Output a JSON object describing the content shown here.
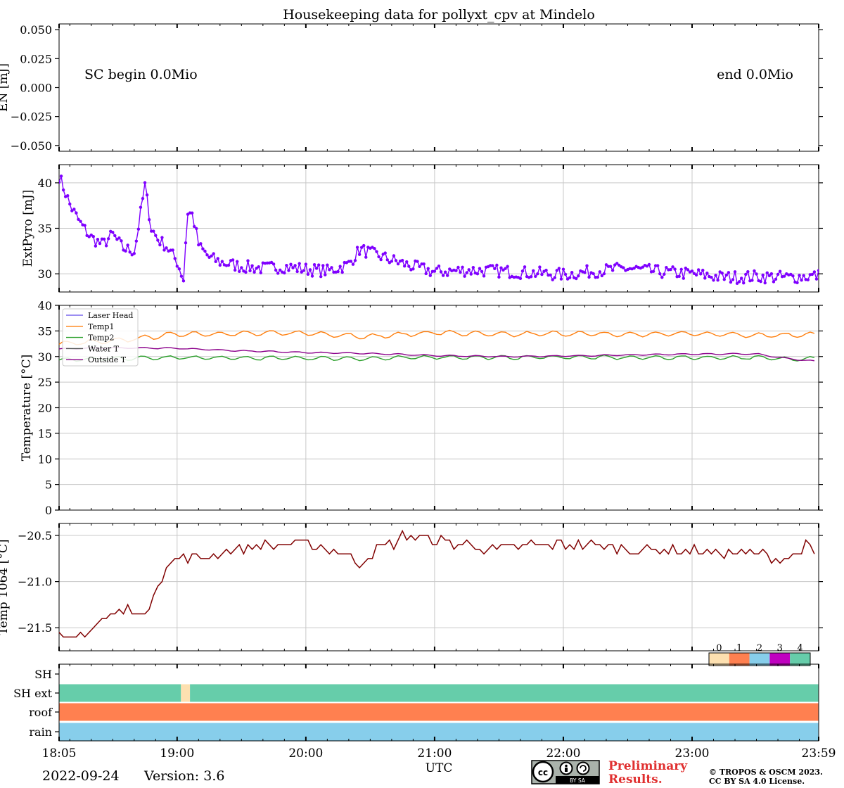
{
  "figure": {
    "title": "Housekeeping data for pollyxt_cpv at Mindelo",
    "date_label": "2022-09-24",
    "version_label": "Version: 3.6",
    "preliminary_line1": "Preliminary",
    "preliminary_line2": "Results.",
    "copyright_line1": "© TROPOS & OSCM 2023.",
    "copyright_line2": "CC BY SA 4.0 License.",
    "license_badge_text": "BY SA",
    "colors": {
      "extpyro": "#7f00ff",
      "temp1": "#ff7f0e",
      "temp2": "#2ca02c",
      "outside": "#8b008b",
      "temp1064": "#800000",
      "grid": "#c8c8c8",
      "preliminary": "#e03030"
    }
  },
  "chart_data": [
    {
      "type": "line",
      "panel": "energy",
      "ylabel": "EN [mJ]",
      "ylim": [
        -0.055,
        0.055
      ],
      "yticks": [
        -0.05,
        -0.025,
        0.0,
        0.025,
        0.05
      ],
      "ytick_labels": [
        "−0.050",
        "−0.025",
        "0.000",
        "0.025",
        "0.050"
      ],
      "annotations": [
        "SC begin 0.0Mio",
        "end 0.0Mio"
      ],
      "series": []
    },
    {
      "type": "line",
      "panel": "extpyro",
      "ylabel": "ExtPyro [mJ]",
      "ylim": [
        28,
        42
      ],
      "yticks": [
        30,
        35,
        40
      ],
      "ytick_labels": [
        "30",
        "35",
        "40"
      ],
      "x_hours_utc": [
        18.08,
        18.17,
        18.25,
        18.33,
        18.42,
        18.5,
        18.58,
        18.67,
        18.72,
        18.75,
        18.8,
        18.85,
        18.92,
        19.0,
        19.05,
        19.08,
        19.12,
        19.17,
        19.25,
        19.33,
        19.5,
        19.67,
        19.83,
        20.0,
        20.17,
        20.33,
        20.42,
        20.5,
        20.67,
        20.83,
        21.0,
        21.25,
        21.5,
        21.75,
        22.0,
        22.25,
        22.5,
        22.75,
        23.0,
        23.25,
        23.5,
        23.75,
        23.98
      ],
      "series": [
        {
          "name": "ExtPyro",
          "values": [
            40.9,
            37.5,
            35.5,
            34.0,
            33.2,
            34.3,
            32.8,
            32.5,
            37.0,
            39.7,
            35.0,
            33.8,
            33.0,
            31.3,
            29.4,
            36.8,
            36.5,
            33.0,
            31.8,
            31.3,
            30.8,
            30.6,
            30.8,
            30.5,
            30.3,
            31.0,
            32.7,
            32.3,
            31.5,
            30.8,
            30.2,
            30.4,
            30.3,
            30.1,
            29.9,
            30.3,
            30.6,
            30.2,
            30.0,
            29.6,
            29.7,
            29.6,
            29.8
          ]
        }
      ]
    },
    {
      "type": "line",
      "panel": "temperature",
      "ylabel": "Temperature [$^\\circ C$]",
      "ylabel_text": "Temperature [°C]",
      "ylim": [
        0,
        40
      ],
      "yticks": [
        0,
        5,
        10,
        15,
        20,
        25,
        30,
        35,
        40
      ],
      "ytick_labels": [
        "0",
        "5",
        "10",
        "15",
        "20",
        "25",
        "30",
        "35",
        "40"
      ],
      "legend_placement": "top-left",
      "x_hours_utc": [
        18.08,
        18.5,
        19.0,
        19.5,
        20.0,
        20.5,
        21.0,
        21.5,
        22.0,
        22.5,
        23.0,
        23.5,
        23.75,
        23.98
      ],
      "series": [
        {
          "name": "Laser Head",
          "values": []
        },
        {
          "name": "Temp1",
          "values": [
            32.5,
            33.0,
            34.4,
            34.5,
            34.6,
            33.9,
            34.7,
            34.3,
            34.5,
            34.3,
            34.5,
            34.2,
            34.2,
            34.4
          ]
        },
        {
          "name": "Temp2",
          "values": [
            29.3,
            29.6,
            29.8,
            29.7,
            29.7,
            29.6,
            29.9,
            29.8,
            29.9,
            29.8,
            29.8,
            29.8,
            29.5,
            29.7
          ]
        },
        {
          "name": "Water T",
          "values": []
        },
        {
          "name": "Outside T",
          "values": [
            31.5,
            31.7,
            31.6,
            31.1,
            30.8,
            30.6,
            30.2,
            30.0,
            30.1,
            30.3,
            30.5,
            30.5,
            29.6,
            29.0
          ]
        }
      ]
    },
    {
      "type": "line",
      "panel": "temp1064",
      "ylabel": "Temp 1064 [$^\\circ C$]",
      "ylabel_text": "Temp 1064 [°C]",
      "ylim": [
        -21.75,
        -20.37
      ],
      "yticks": [
        -21.5,
        -21.0,
        -20.5
      ],
      "ytick_labels": [
        "−21.5",
        "−21.0",
        "−20.5"
      ],
      "x_hours_utc": [
        18.08,
        18.17,
        18.25,
        18.33,
        18.5,
        18.67,
        18.75,
        18.83,
        18.92,
        19.0,
        19.17,
        19.33,
        19.5,
        19.67,
        19.83,
        20.0,
        20.25,
        20.42,
        20.5,
        20.67,
        20.75,
        21.0,
        21.25,
        21.5,
        21.75,
        22.0,
        22.25,
        22.5,
        22.75,
        23.0,
        23.25,
        23.5,
        23.75,
        23.9,
        23.98
      ],
      "series": [
        {
          "name": "Temp 1064",
          "values": [
            -21.6,
            -21.65,
            -21.55,
            -21.5,
            -21.35,
            -21.3,
            -21.4,
            -21.05,
            -20.85,
            -20.75,
            -20.75,
            -20.7,
            -20.65,
            -20.6,
            -20.6,
            -20.6,
            -20.65,
            -20.8,
            -20.7,
            -20.6,
            -20.5,
            -20.55,
            -20.6,
            -20.65,
            -20.6,
            -20.6,
            -20.6,
            -20.65,
            -20.65,
            -20.65,
            -20.7,
            -20.7,
            -20.75,
            -20.6,
            -20.8
          ]
        }
      ]
    },
    {
      "type": "heatmap",
      "panel": "status",
      "rows": [
        "SH",
        "SH ext",
        "roof",
        "rain"
      ],
      "colorbar_ticks": [
        "0",
        "1",
        "2",
        "3",
        "4"
      ],
      "colorbar_colors": [
        "#fde0b0",
        "#ff8050",
        "#87ceeb",
        "#c000c0",
        "#66cdaa"
      ],
      "segments": [
        {
          "row": "SH",
          "from": 18.08,
          "to": 23.98,
          "state": null
        },
        {
          "row": "SH ext",
          "from": 18.08,
          "to": 19.03,
          "state": 4
        },
        {
          "row": "SH ext",
          "from": 19.03,
          "to": 19.1,
          "state": 0
        },
        {
          "row": "SH ext",
          "from": 19.1,
          "to": 23.98,
          "state": 4
        },
        {
          "row": "roof",
          "from": 18.08,
          "to": 23.98,
          "state": 1
        },
        {
          "row": "rain",
          "from": 18.08,
          "to": 23.98,
          "state": 2
        }
      ],
      "xlabel": "UTC",
      "xlim": [
        18.0833,
        23.9833
      ],
      "xticks": [
        18.0833,
        19.0,
        20.0,
        21.0,
        22.0,
        23.0,
        23.9833
      ],
      "xtick_labels": [
        "18:05",
        "19:00",
        "20:00",
        "21:00",
        "22:00",
        "23:00",
        "23:59"
      ]
    }
  ]
}
